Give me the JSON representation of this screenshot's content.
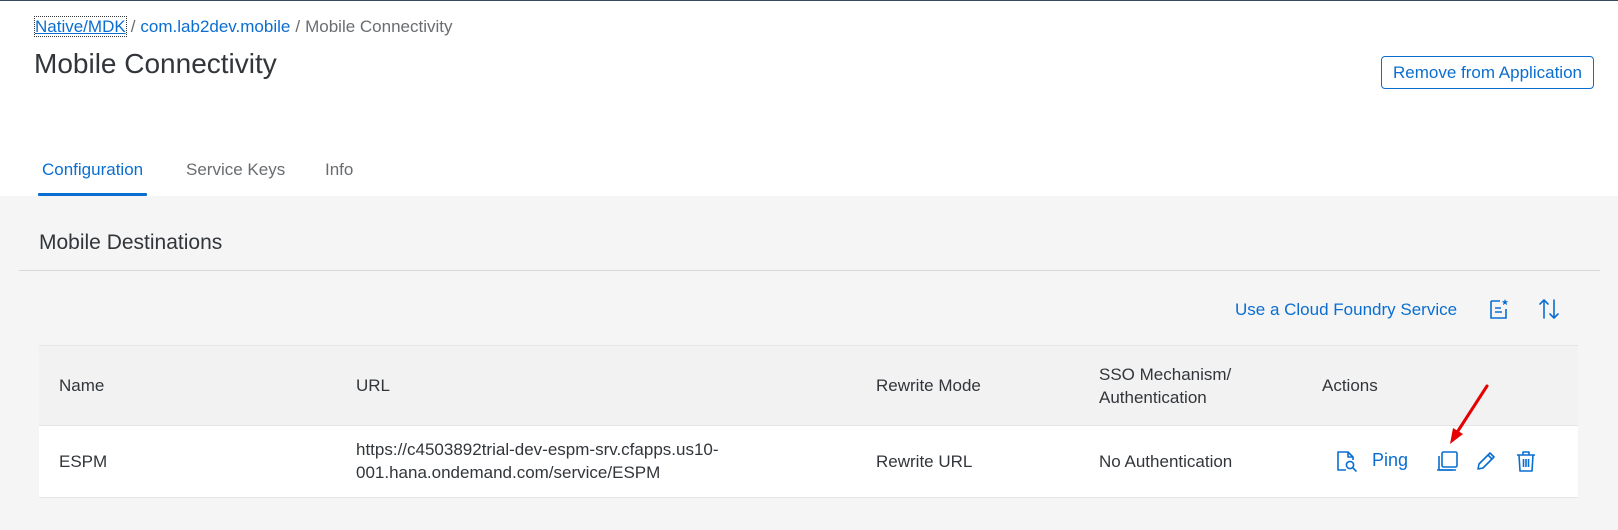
{
  "breadcrumb": {
    "items": [
      "Native/MDK",
      "com.lab2dev.mobile"
    ],
    "current": "Mobile Connectivity",
    "separator": "/"
  },
  "page": {
    "title": "Mobile Connectivity",
    "remove_button": "Remove from Application"
  },
  "tabs": [
    {
      "label": "Configuration",
      "active": true
    },
    {
      "label": "Service Keys",
      "active": false
    },
    {
      "label": "Info",
      "active": false
    }
  ],
  "section": {
    "title": "Mobile Destinations",
    "toolbar": {
      "cf_link": "Use a Cloud Foundry Service",
      "icons": [
        "new-destination-icon",
        "sort-icon"
      ]
    }
  },
  "table": {
    "columns": [
      "Name",
      "URL",
      "Rewrite Mode",
      "SSO Mechanism/",
      "Authentication",
      "Actions"
    ],
    "rows": [
      {
        "name": "ESPM",
        "url_line1": "https://c4503892trial-dev-espm-srv.cfapps.us10-",
        "url_line2": "001.hana.ondemand.com/service/ESPM",
        "rewrite_mode": "Rewrite URL",
        "sso": "No Authentication",
        "ping_label": "Ping",
        "action_icons": [
          "inspect-icon",
          "copy-icon",
          "edit-icon",
          "delete-icon"
        ]
      }
    ]
  },
  "colors": {
    "accent": "#0a6ed1",
    "text": "#32363a",
    "muted": "#6a6d70",
    "annotation_arrow": "#e60000"
  }
}
